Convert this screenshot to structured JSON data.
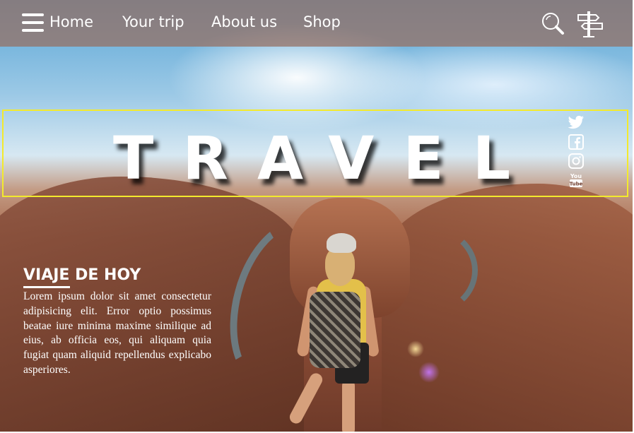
{
  "nav": {
    "menu_icon": "hamburger-menu-icon",
    "links": [
      "Home",
      "Your trip",
      "About us",
      "Shop"
    ],
    "icons": [
      "search-icon",
      "signpost-icon"
    ]
  },
  "hero": {
    "title": "TRAVEL",
    "accent_border_color": "#f3ea2d"
  },
  "social": {
    "icons": [
      "twitter-icon",
      "facebook-icon",
      "instagram-icon",
      "youtube-icon"
    ],
    "youtube_text_top": "You",
    "youtube_text_bottom": "Tube"
  },
  "article": {
    "title": "VIAJE DE HOY",
    "body": "Lorem ipsum dolor sit amet consectetur adipisicing elit. Error optio possimus beatae iure minima maxime similique ad eius, ab officia eos, qui aliquam quia fugiat quam aliquid repellendus explicabo asperiores."
  }
}
